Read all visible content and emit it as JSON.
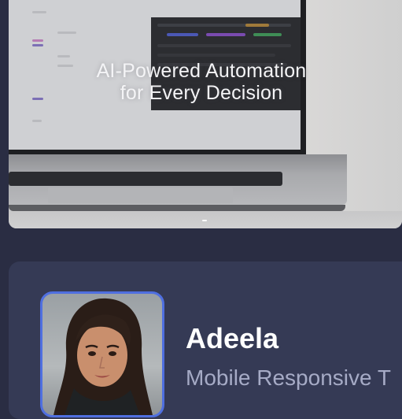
{
  "hero": {
    "headline_line1": "AI-Powered Automation",
    "headline_line2": "for Every Decision",
    "image_subject": "laptop-showing-dashboard"
  },
  "profile": {
    "name": "Adeela",
    "role": "Mobile Responsive T",
    "avatar_subject": "woman-portrait",
    "avatar_border_color": "#4f6fe0"
  },
  "colors": {
    "page_background": "#2a2d43",
    "card_background": "#353a55",
    "name_color": "#ffffff",
    "role_color": "#a6abc6"
  }
}
